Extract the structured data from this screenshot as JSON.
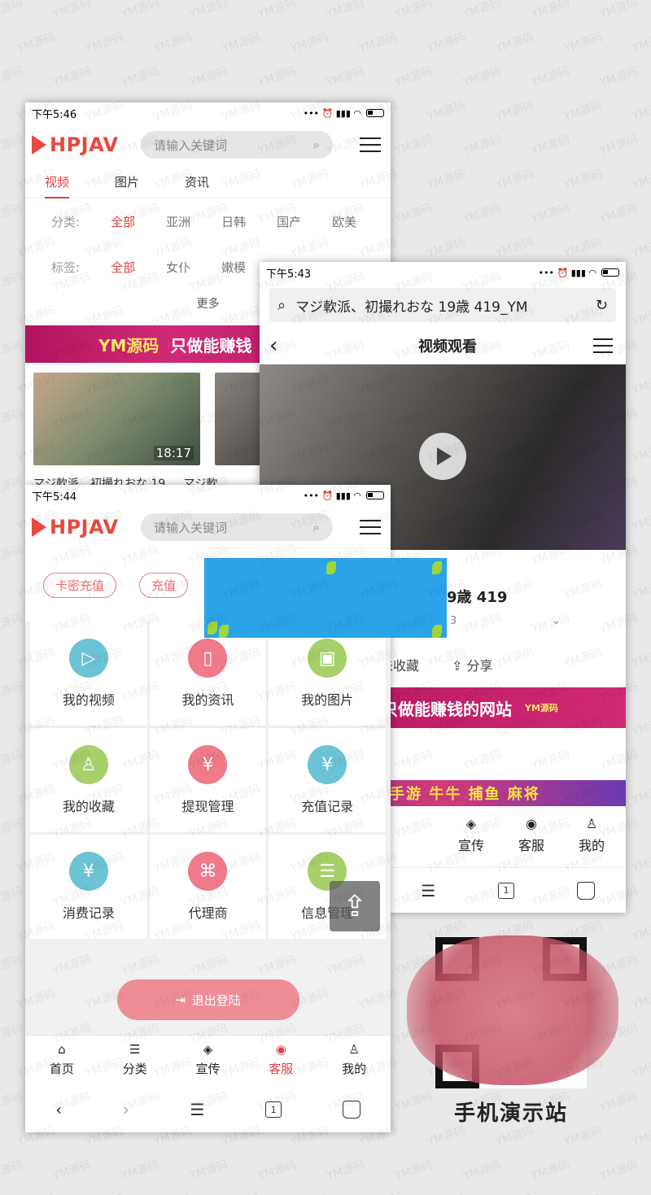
{
  "phone1": {
    "time": "下午5:46",
    "logo": "HPJAV",
    "search_placeholder": "请输入关键词",
    "tabs": [
      "视频",
      "图片",
      "资讯"
    ],
    "category_label": "分类:",
    "categories": [
      "全部",
      "亚洲",
      "日韩",
      "国产",
      "欧美"
    ],
    "tag_label": "标签:",
    "tags": [
      "全部",
      "女仆",
      "嫩模"
    ],
    "more": "更多",
    "banner_brand": "YM源码",
    "banner_slogan": "只做能赚钱",
    "thumb_duration": "18:17",
    "thumb_title": "マジ軟派、初撮れおな 19",
    "thumb_title2": "マジ軟"
  },
  "phone2": {
    "time": "下午5:43",
    "url": "マジ軟派、初撮れおな 19歳 419_YM",
    "title": "视频观看",
    "video_title": "9歳 419",
    "video_meta": "3",
    "action_collect": "未收藏",
    "action_share": "分享",
    "banner_slogan": "只做能赚钱的网站",
    "banner_tag": "YM源码",
    "game_text": "手游 牛牛 捕鱼 麻将",
    "nav": [
      "宣传",
      "客服",
      "我的"
    ]
  },
  "phone3": {
    "time": "下午5:44",
    "logo": "HPJAV",
    "search_placeholder": "请输入关键词",
    "recharge_card": "卡密充值",
    "recharge_other": "充值",
    "grid": [
      {
        "label": "我的视频",
        "icon": "video-icon",
        "color": "#6cc3d5"
      },
      {
        "label": "我的资讯",
        "icon": "book-icon",
        "color": "#ef7a8a"
      },
      {
        "label": "我的图片",
        "icon": "image-icon",
        "color": "#a6d06a"
      },
      {
        "label": "我的收藏",
        "icon": "user-list-icon",
        "color": "#a6d06a"
      },
      {
        "label": "提现管理",
        "icon": "money-bag-icon",
        "color": "#ef7a8a"
      },
      {
        "label": "充值记录",
        "icon": "yen-plus-icon",
        "color": "#6cc3d5"
      },
      {
        "label": "消费记录",
        "icon": "receipt-icon",
        "color": "#6cc3d5"
      },
      {
        "label": "代理商",
        "icon": "org-chart-icon",
        "color": "#ef7a8a"
      },
      {
        "label": "信息管理",
        "icon": "profile-card-icon",
        "color": "#a6d06a"
      }
    ],
    "logout": "退出登陆",
    "nav": [
      "首页",
      "分类",
      "宣传",
      "客服",
      "我的"
    ]
  },
  "qr_caption": "手机演示站",
  "watermark": "YM源码",
  "page_num": "1"
}
